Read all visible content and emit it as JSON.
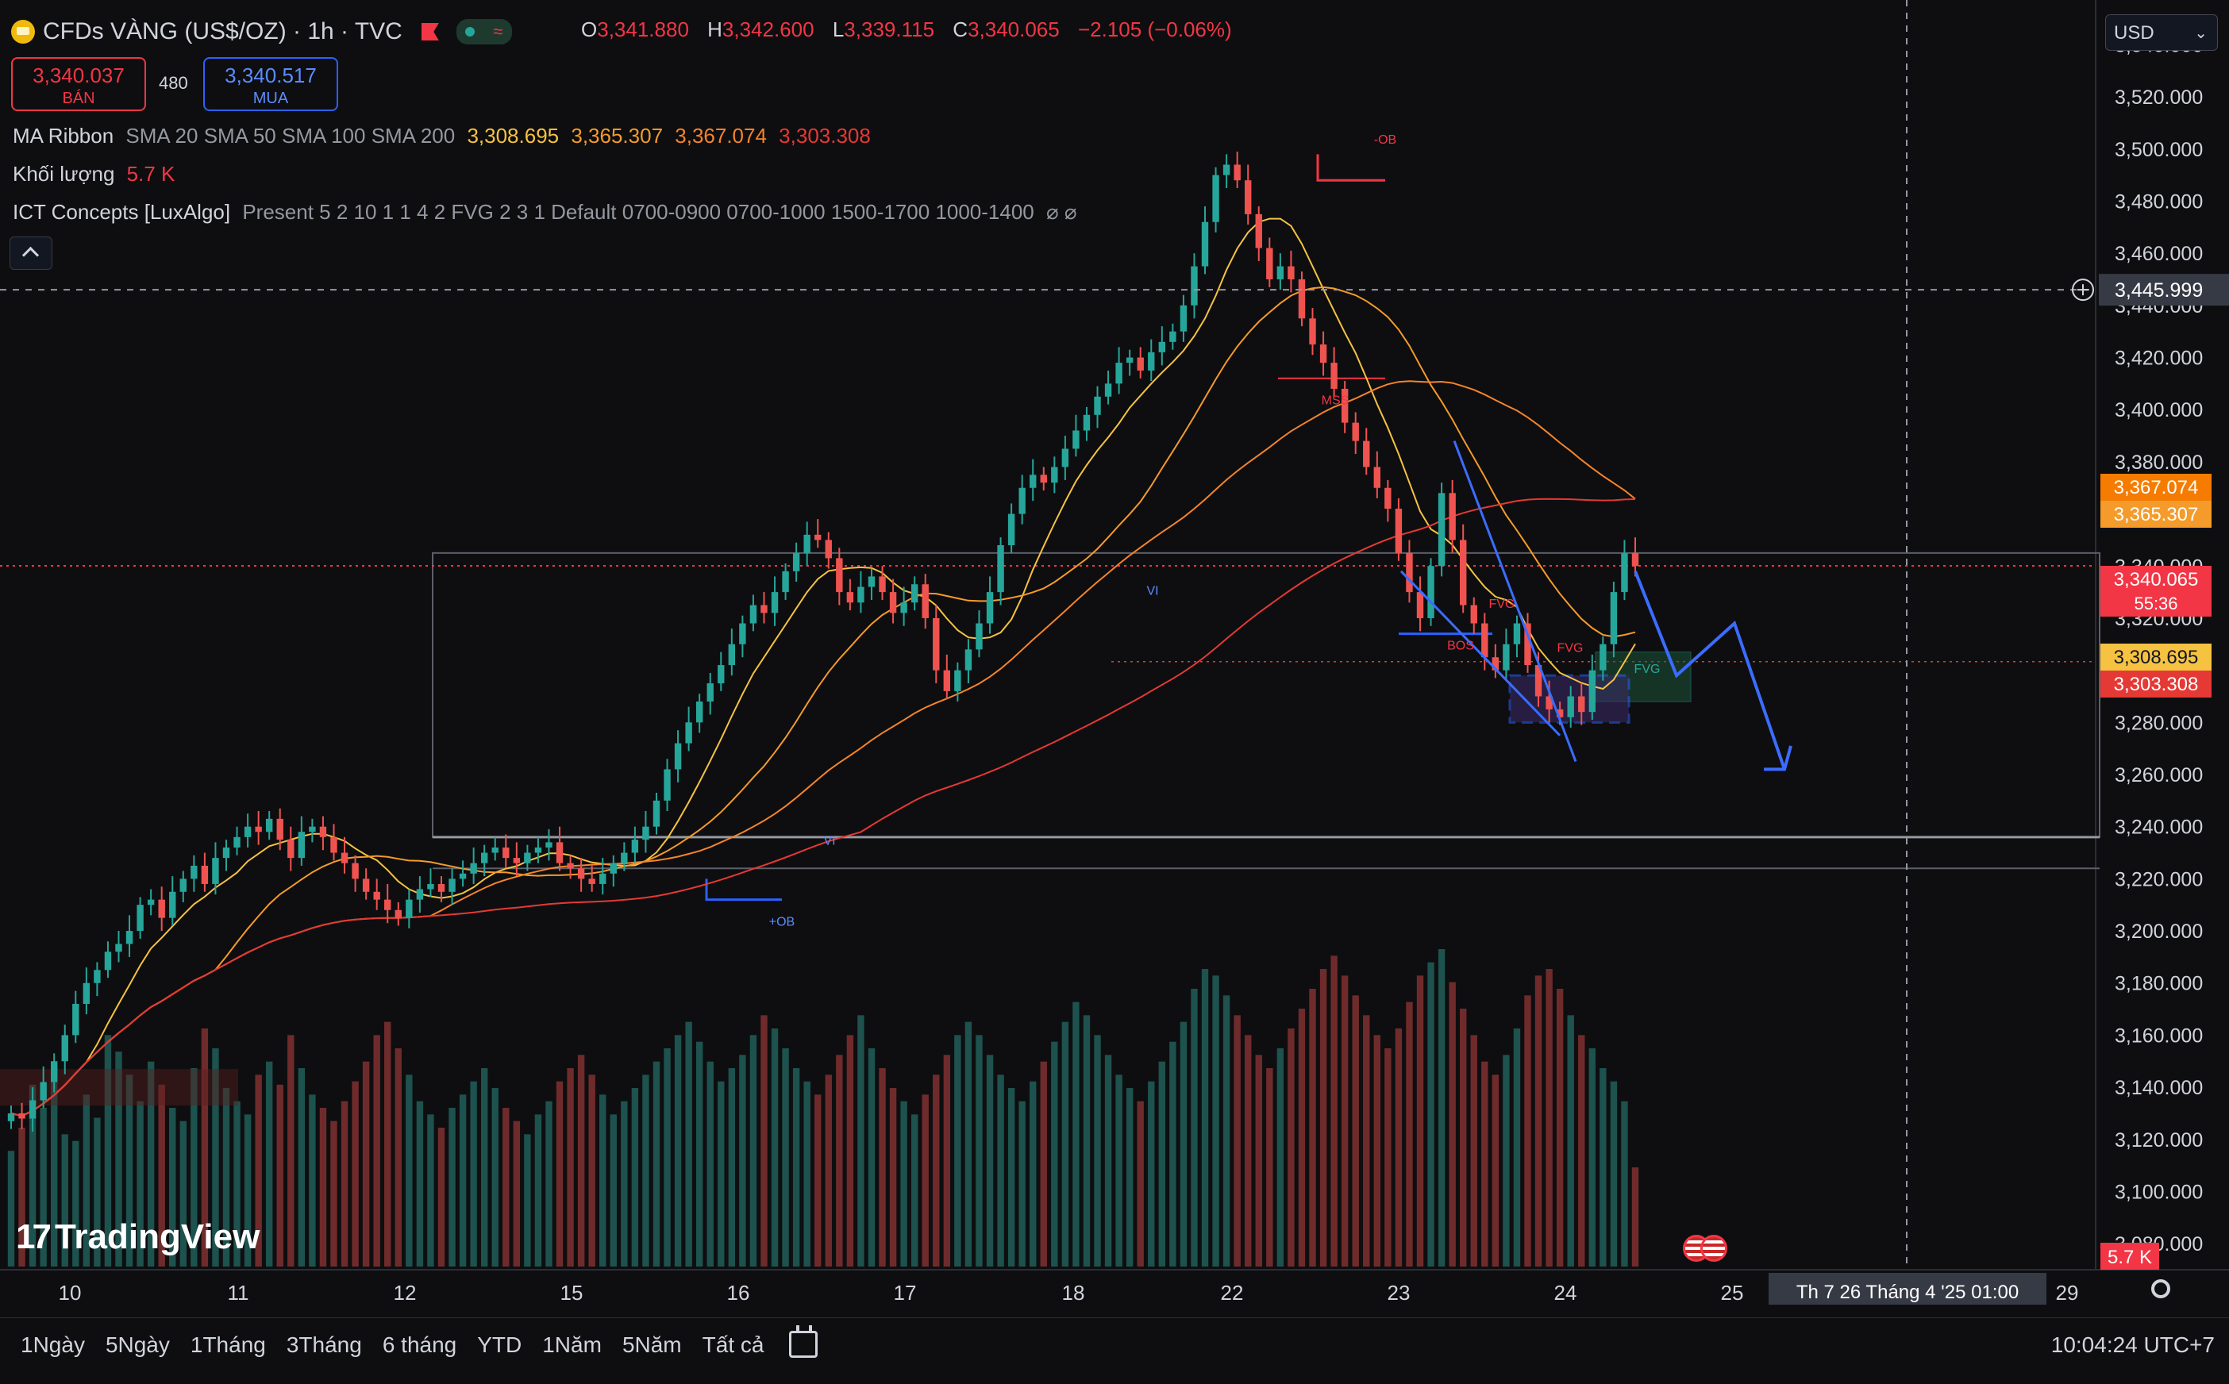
{
  "header": {
    "symbol_title": "CFDs VÀNG (US$/OZ) · 1h · TVC",
    "ohlc": [
      {
        "key": "O",
        "value": "3,341.880"
      },
      {
        "key": "H",
        "value": "3,342.600"
      },
      {
        "key": "L",
        "value": "3,339.115"
      },
      {
        "key": "C",
        "value": "3,340.065"
      },
      {
        "key": "",
        "value": "−2.105 (−0.06%)"
      }
    ],
    "sell_price": "3,340.037",
    "sell_label": "BÁN",
    "spread": "480",
    "buy_price": "3,340.517",
    "buy_label": "MUA",
    "currency": "USD"
  },
  "indicators": {
    "ma_ribbon_name": "MA Ribbon",
    "ma_ribbon_params": "SMA 20 SMA 50 SMA 100 SMA 200",
    "ma_values": [
      {
        "value": "3,308.695",
        "color": "#f5c242"
      },
      {
        "value": "3,365.307",
        "color": "#f59b2b"
      },
      {
        "value": "3,367.074",
        "color": "#f5842b"
      },
      {
        "value": "3,303.308",
        "color": "#e53935"
      }
    ],
    "volume_name": "Khối lượng",
    "volume_value": "5.7 K",
    "ict_name": "ICT Concepts [LuxAlgo]",
    "ict_params": "Present 5 2 10 1 1 4 2 FVG 2 3 1 Default 0700-0900 0700-1000 1500-1700 1000-1400",
    "ict_icons": "⌀ ⌀"
  },
  "chart_data": {
    "type": "candlestick",
    "yaxis_ticks": [
      "3,540.000",
      "3,520.000",
      "3,500.000",
      "3,480.000",
      "3,460.000",
      "3,440.000",
      "3,420.000",
      "3,400.000",
      "3,380.000",
      "3,360.000",
      "3,340.000",
      "3,320.000",
      "3,300.000",
      "3,280.000",
      "3,260.000",
      "3,240.000",
      "3,220.000",
      "3,200.000",
      "3,180.000",
      "3,160.000",
      "3,140.000",
      "3,120.000",
      "3,100.000",
      "3,080.000"
    ],
    "ylim": [
      3070,
      3545
    ],
    "xaxis_ticks": [
      "10",
      "11",
      "12",
      "15",
      "16",
      "17",
      "18",
      "22",
      "23",
      "24",
      "25",
      "29"
    ],
    "crosshair_price": "3,445.999",
    "crosshair_time": "Th 7 26 Tháng 4 '25   01:00",
    "price_labels": [
      {
        "value": "3,367.074",
        "price": 3367.074,
        "color": "#f57c00"
      },
      {
        "value": "3,365.307",
        "price": 3365.307,
        "color": "#f59b2b"
      },
      {
        "value": "3,340.065",
        "price": 3340.065,
        "color": "#f23645",
        "sub": "55:36"
      },
      {
        "value": "3,308.695",
        "price": 3308.695,
        "color": "#f5c242"
      },
      {
        "value": "3,303.308",
        "price": 3303.308,
        "color": "#e53935"
      }
    ],
    "volume_label": "5.7 K",
    "annotations": [
      "-OB",
      "MSS",
      "VI",
      "VI",
      "+OB",
      "BOS",
      "FVG",
      "FVG",
      "FVG"
    ],
    "candle_closes": [
      3130,
      3128,
      3135,
      3142,
      3150,
      3160,
      3172,
      3180,
      3185,
      3192,
      3195,
      3200,
      3210,
      3212,
      3205,
      3215,
      3220,
      3225,
      3218,
      3228,
      3232,
      3236,
      3240,
      3238,
      3243,
      3235,
      3228,
      3238,
      3240,
      3236,
      3230,
      3226,
      3220,
      3215,
      3212,
      3208,
      3205,
      3212,
      3216,
      3218,
      3215,
      3220,
      3222,
      3226,
      3230,
      3232,
      3228,
      3226,
      3230,
      3232,
      3234,
      3226,
      3224,
      3220,
      3218,
      3222,
      3226,
      3230,
      3235,
      3240,
      3250,
      3262,
      3272,
      3280,
      3288,
      3295,
      3302,
      3310,
      3318,
      3325,
      3322,
      3330,
      3338,
      3345,
      3352,
      3350,
      3343,
      3330,
      3326,
      3332,
      3336,
      3330,
      3322,
      3326,
      3333,
      3320,
      3300,
      3292,
      3300,
      3308,
      3318,
      3330,
      3348,
      3360,
      3370,
      3375,
      3372,
      3378,
      3385,
      3392,
      3398,
      3405,
      3410,
      3418,
      3420,
      3415,
      3422,
      3426,
      3430,
      3440,
      3455,
      3472,
      3490,
      3494,
      3488,
      3475,
      3462,
      3450,
      3455,
      3450,
      3435,
      3425,
      3418,
      3408,
      3395,
      3388,
      3378,
      3370,
      3362,
      3345,
      3330,
      3320,
      3340,
      3368,
      3350,
      3325,
      3318,
      3305,
      3300,
      3310,
      3318,
      3302,
      3290,
      3285,
      3282,
      3290,
      3284,
      3300,
      3310,
      3330,
      3345,
      3340
    ],
    "volumes": [
      35,
      42,
      55,
      48,
      60,
      40,
      38,
      52,
      45,
      70,
      65,
      58,
      50,
      62,
      55,
      48,
      44,
      60,
      72,
      66,
      54,
      50,
      46,
      58,
      62,
      55,
      70,
      60,
      52,
      48,
      44,
      50,
      56,
      62,
      70,
      74,
      66,
      58,
      50,
      46,
      42,
      48,
      52,
      56,
      60,
      54,
      48,
      44,
      40,
      46,
      50,
      56,
      60,
      64,
      58,
      52,
      46,
      50,
      54,
      58,
      62,
      66,
      70,
      74,
      68,
      62,
      56,
      60,
      64,
      70,
      76,
      72,
      66,
      60,
      56,
      52,
      58,
      64,
      70,
      76,
      66,
      60,
      54,
      50,
      46,
      52,
      58,
      64,
      70,
      74,
      70,
      64,
      58,
      54,
      50,
      56,
      62,
      68,
      74,
      80,
      76,
      70,
      64,
      58,
      54,
      50,
      56,
      62,
      68,
      74,
      84,
      90,
      88,
      82,
      76,
      70,
      64,
      60,
      66,
      72,
      78,
      84,
      90,
      94,
      88,
      82,
      76,
      70,
      66,
      72,
      80,
      88,
      92,
      96,
      86,
      78,
      70,
      62,
      58,
      64,
      72,
      82,
      88,
      90,
      84,
      76,
      70,
      66,
      60,
      56,
      50,
      30
    ]
  },
  "watermark": "TradingView",
  "bottom_bar": {
    "ranges": [
      "1Ngày",
      "5Ngày",
      "1Tháng",
      "3Tháng",
      "6 tháng",
      "YTD",
      "1Năm",
      "5Năm",
      "Tất cả"
    ],
    "clock": "10:04:24 UTC+7"
  }
}
